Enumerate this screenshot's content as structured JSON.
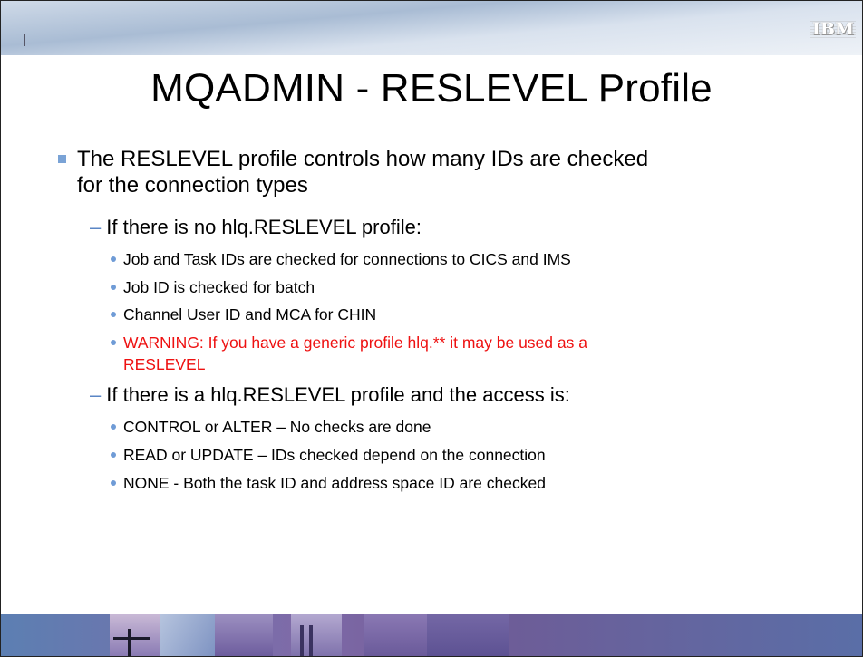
{
  "slide": {
    "title": "MQADMIN - RESLEVEL Profile",
    "logo_text": "IBM",
    "items": [
      {
        "level": 1,
        "text": "The RESLEVEL profile controls how many IDs are checked for the connection types"
      },
      {
        "level": 2,
        "text": "If there is no hlq.RESLEVEL profile:"
      },
      {
        "level": 3,
        "text": "Job and Task IDs are checked for connections to CICS and IMS"
      },
      {
        "level": 3,
        "text": "Job ID is checked for batch"
      },
      {
        "level": 3,
        "text": "Channel User ID and MCA for CHIN"
      },
      {
        "level": 3,
        "text": "WARNING:  If you have a generic profile hlq.** it may be used as a RESLEVEL",
        "warning": true
      },
      {
        "level": 2,
        "text": "If there is a hlq.RESLEVEL profile and the access is:"
      },
      {
        "level": 3,
        "text": "CONTROL or ALTER – No checks are done"
      },
      {
        "level": 3,
        "text": "READ or UPDATE – IDs checked depend on the connection"
      },
      {
        "level": 3,
        "text": "NONE - Both the task ID and address space ID are checked"
      }
    ],
    "dash_glyph": "–"
  },
  "colors": {
    "bullet_blue": "#7aa3d6",
    "warning_red": "#ee1111",
    "footer_purple": "#6f5b96"
  }
}
